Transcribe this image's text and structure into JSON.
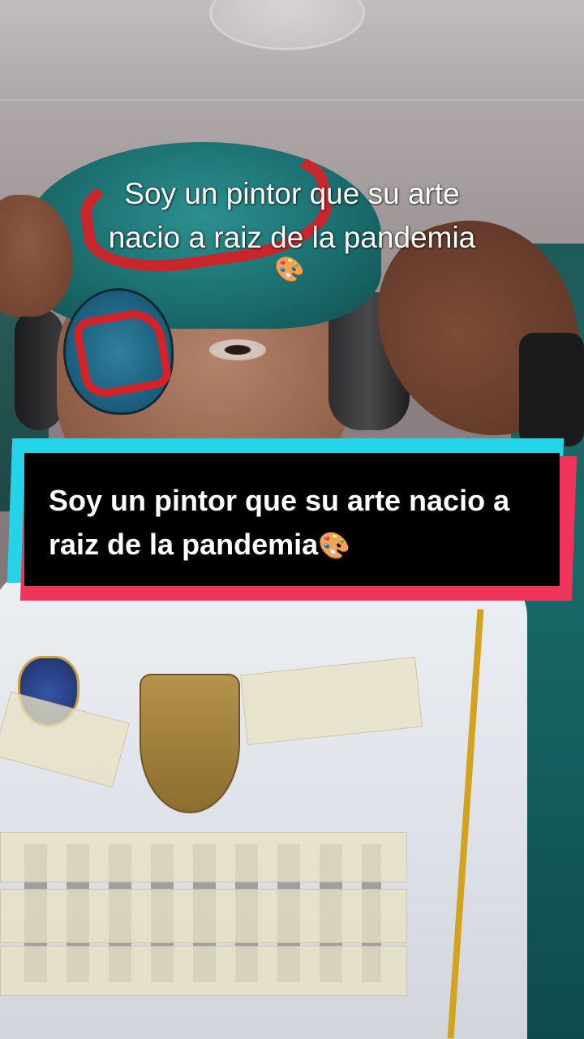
{
  "overlay_caption": {
    "line1": "Soy un pintor que su arte",
    "line2": "nacio a raiz de la pandemia"
  },
  "caption_box": {
    "text": "Soy un pintor que su arte nacio a raiz de la pandemia",
    "emoji": "🎨",
    "colors": {
      "box": "#000000",
      "text": "#ffffff",
      "accent_cyan": "#25d3e8",
      "accent_red": "#f0345a"
    }
  },
  "cap_emoji": "🎨"
}
